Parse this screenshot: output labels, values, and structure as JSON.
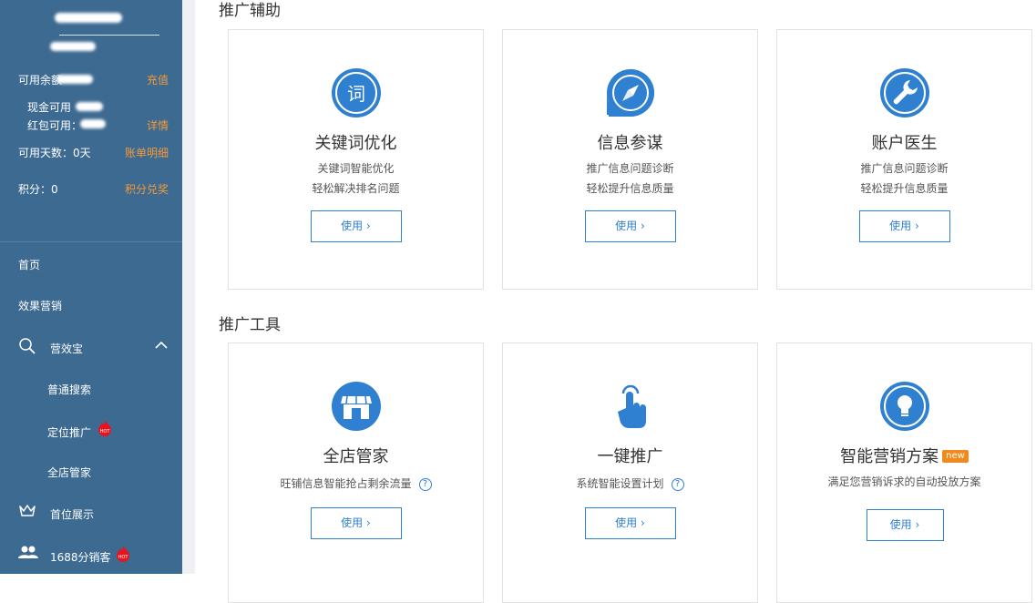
{
  "sidebar": {
    "account": {
      "balance_label": "可用余额",
      "recharge": "充值",
      "cash_label": "现金可用",
      "redpacket_label": "红包可用：",
      "details": "详情",
      "days_label": "可用天数：0天",
      "bill": "账单明细",
      "points_label": "积分：0",
      "redeem": "积分兑奖"
    },
    "nav": {
      "home": "首页",
      "marketing": "效果营销",
      "yingxiaobao": "营效宝",
      "normal_search": "普通搜索",
      "location_promo": "定位推广",
      "store_manager": "全店管家",
      "top_display": "首位展示",
      "distributor": "1688分销客",
      "hot_badge": "HOT"
    }
  },
  "sections": {
    "assist_title": "推广辅助",
    "tools_title": "推广工具"
  },
  "assist_cards": [
    {
      "title": "关键词优化",
      "desc1": "关键词智能优化",
      "desc2": "轻松解决排名问题",
      "button": "使用",
      "icon": "keyword-icon",
      "icon_text": "词"
    },
    {
      "title": "信息参谋",
      "desc1": "推广信息问题诊断",
      "desc2": "轻松提升信息质量",
      "button": "使用",
      "icon": "compass-icon"
    },
    {
      "title": "账户医生",
      "desc1": "推广信息问题诊断",
      "desc2": "轻松提升信息质量",
      "button": "使用",
      "icon": "wrench-icon"
    }
  ],
  "tool_cards": [
    {
      "title": "全店管家",
      "desc": "旺铺信息智能抢占剩余流量",
      "button": "使用",
      "icon": "store-icon"
    },
    {
      "title": "一键推广",
      "desc": "系统智能设置计划",
      "button": "使用",
      "icon": "tap-hand-icon"
    },
    {
      "title": "智能营销方案",
      "badge": "new",
      "desc": "满足您营销诉求的自动投放方案",
      "button": "使用",
      "icon": "lightbulb-icon"
    }
  ],
  "colors": {
    "sidebar": "#3d6a91",
    "accent": "#2f80d1",
    "link": "#f39a3a"
  }
}
